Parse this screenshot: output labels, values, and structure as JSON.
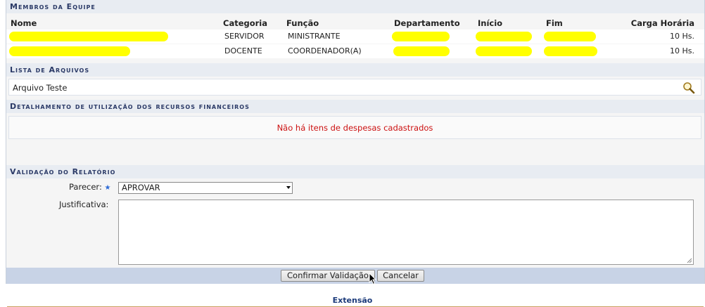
{
  "team": {
    "title": "Membros da Equipe",
    "headers": {
      "nome": "Nome",
      "categoria": "Categoria",
      "funcao": "Função",
      "departamento": "Departamento",
      "inicio": "Início",
      "fim": "Fim",
      "carga": "Carga Horária"
    },
    "rows": [
      {
        "categoria": "SERVIDOR",
        "funcao": "MINISTRANTE",
        "carga": "10 Hs."
      },
      {
        "categoria": "DOCENTE",
        "funcao": "COORDENADOR(A)",
        "carga": "10 Hs."
      }
    ],
    "redaction_color": "#ffff00"
  },
  "files": {
    "title": "Lista de Arquivos",
    "items": [
      {
        "name": "Arquivo Teste",
        "icon": "magnifier-icon"
      }
    ]
  },
  "expenses": {
    "title": "Detalhamento de utilização dos recursos financeiros",
    "empty_message": "Não há itens de despesas cadastrados"
  },
  "validation": {
    "title": "Validação do Relatório",
    "parecer_label": "Parecer:",
    "parecer_value": "APROVAR",
    "justificativa_label": "Justificativa:",
    "justificativa_value": "",
    "confirm_label": "Confirmar Validação",
    "cancel_label": "Cancelar"
  },
  "footer": {
    "link": "Extensão"
  }
}
